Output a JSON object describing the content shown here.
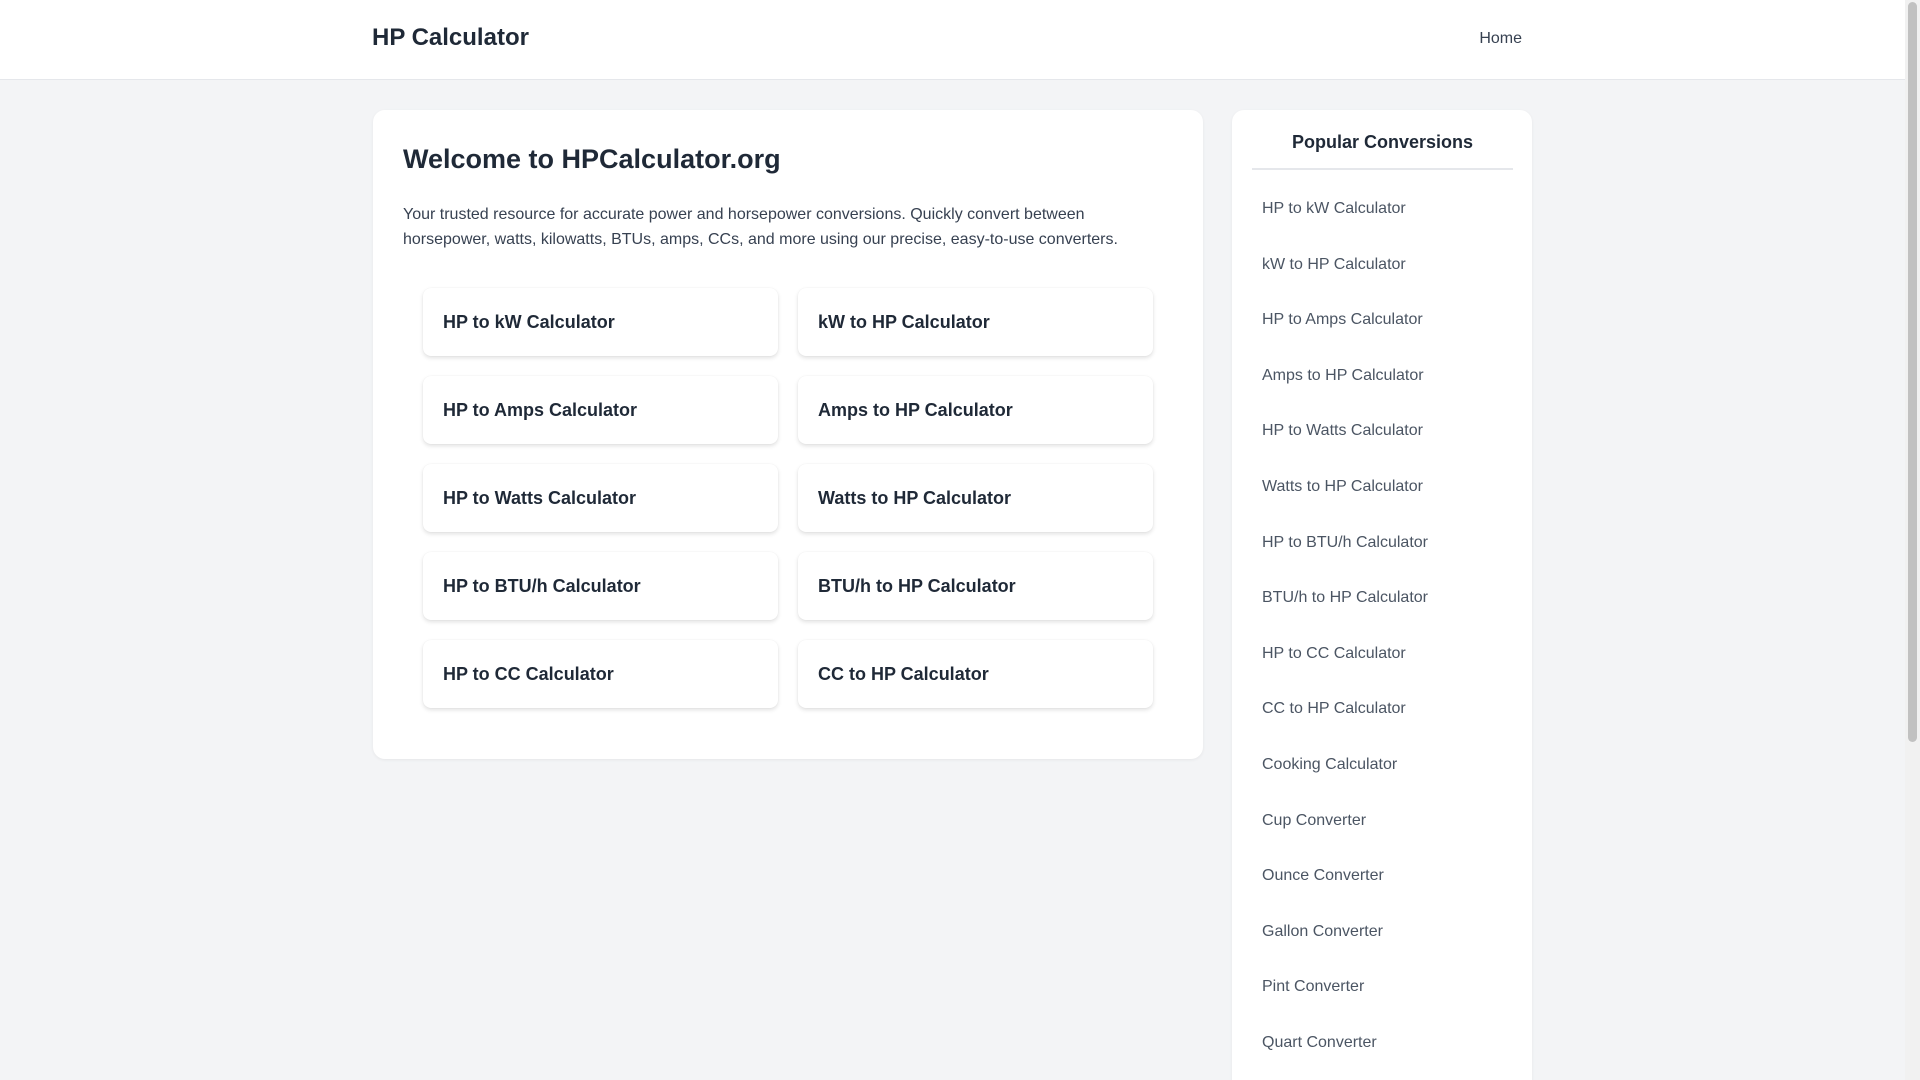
{
  "header": {
    "brand": "HP Calculator",
    "nav_home": "Home"
  },
  "main": {
    "title": "Welcome to HPCalculator.org",
    "intro": "Your trusted resource for accurate power and horsepower conversions. Quickly convert between horsepower, watts, kilowatts, BTUs, amps, CCs, and more using our precise, easy-to-use converters.",
    "tiles": [
      "HP to kW Calculator",
      "kW to HP Calculator",
      "HP to Amps Calculator",
      "Amps to HP Calculator",
      "HP to Watts Calculator",
      "Watts to HP Calculator",
      "HP to BTU/h Calculator",
      "BTU/h to HP Calculator",
      "HP to CC Calculator",
      "CC to HP Calculator"
    ]
  },
  "sidebar": {
    "title": "Popular Conversions",
    "items": [
      "HP to kW Calculator",
      "kW to HP Calculator",
      "HP to Amps Calculator",
      "Amps to HP Calculator",
      "HP to Watts Calculator",
      "Watts to HP Calculator",
      "HP to BTU/h Calculator",
      "BTU/h to HP Calculator",
      "HP to CC Calculator",
      "CC to HP Calculator",
      "Cooking Calculator",
      "Cup Converter",
      "Ounce Converter",
      "Gallon Converter",
      "Pint Converter",
      "Quart Converter"
    ]
  }
}
